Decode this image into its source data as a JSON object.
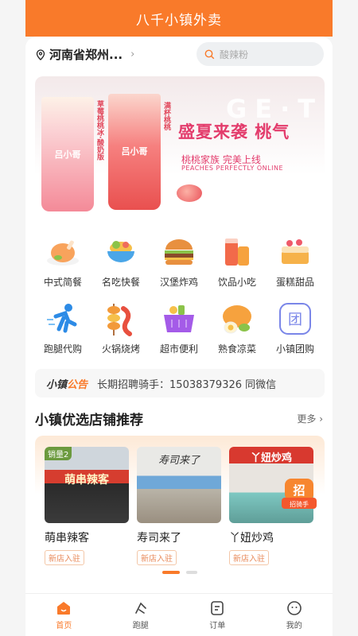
{
  "app": {
    "title": "八千小镇外卖"
  },
  "header": {
    "location": "河南省郑州...",
    "search_placeholder": "酸辣粉"
  },
  "banner": {
    "cup_logo": "吕小哥",
    "cup1_text": "草莓桃桃冰·酸奶版",
    "cup2_text": "满杯桃桃",
    "bg_text": "GE·T",
    "title": "盛夏来袭 桃气",
    "subtitle": "桃桃家族 完美上线",
    "subtitle_en": "PEACHES PERFECTLY ONLINE",
    "active_index": 1
  },
  "categories": [
    {
      "label": "中式简餐",
      "icon": "roast-chicken-icon",
      "color": "#f8a35c"
    },
    {
      "label": "名吃快餐",
      "icon": "bowl-icon",
      "color": "#4aa6e8"
    },
    {
      "label": "汉堡炸鸡",
      "icon": "burger-icon",
      "color": "#e8903f"
    },
    {
      "label": "饮品小吃",
      "icon": "drinks-icon",
      "color": "#f26a4a"
    },
    {
      "label": "蛋糕甜品",
      "icon": "cake-icon",
      "color": "#f6b24a"
    },
    {
      "label": "跑腿代购",
      "icon": "runner-icon",
      "color": "#2d8be6"
    },
    {
      "label": "火锅烧烤",
      "icon": "skewer-icon",
      "color": "#f29a3a"
    },
    {
      "label": "超市便利",
      "icon": "basket-icon",
      "color": "#a45be8"
    },
    {
      "label": "熟食凉菜",
      "icon": "deli-icon",
      "color": "#f6a23e"
    },
    {
      "label": "小镇团购",
      "icon": "group-buy-icon",
      "color": "#7a86e8"
    }
  ],
  "notice": {
    "brand_a": "小镇",
    "brand_b": "公告",
    "text": "长期招聘骑手：15038379326 同微信"
  },
  "section": {
    "title": "小镇优选店铺推荐",
    "more": "更多"
  },
  "shops": [
    {
      "name": "萌串辣客",
      "tag": "新店入驻",
      "badge": "销量2",
      "sign": "萌串辣客"
    },
    {
      "name": "寿司来了",
      "tag": "新店入驻",
      "badge": "",
      "sign": "寿司来了"
    },
    {
      "name": "丫妞炒鸡",
      "tag": "新店入驻",
      "badge": "",
      "sign": "丫妞炒鸡"
    }
  ],
  "hiring_badge": {
    "char": "招",
    "text": "招骑手"
  },
  "tabs": [
    {
      "label": "首页",
      "icon": "home-icon"
    },
    {
      "label": "跑腿",
      "icon": "run-icon"
    },
    {
      "label": "订单",
      "icon": "order-icon"
    },
    {
      "label": "我的",
      "icon": "profile-icon"
    }
  ],
  "colors": {
    "accent": "#f97a2a",
    "banner_pink": "#e33c6c"
  }
}
